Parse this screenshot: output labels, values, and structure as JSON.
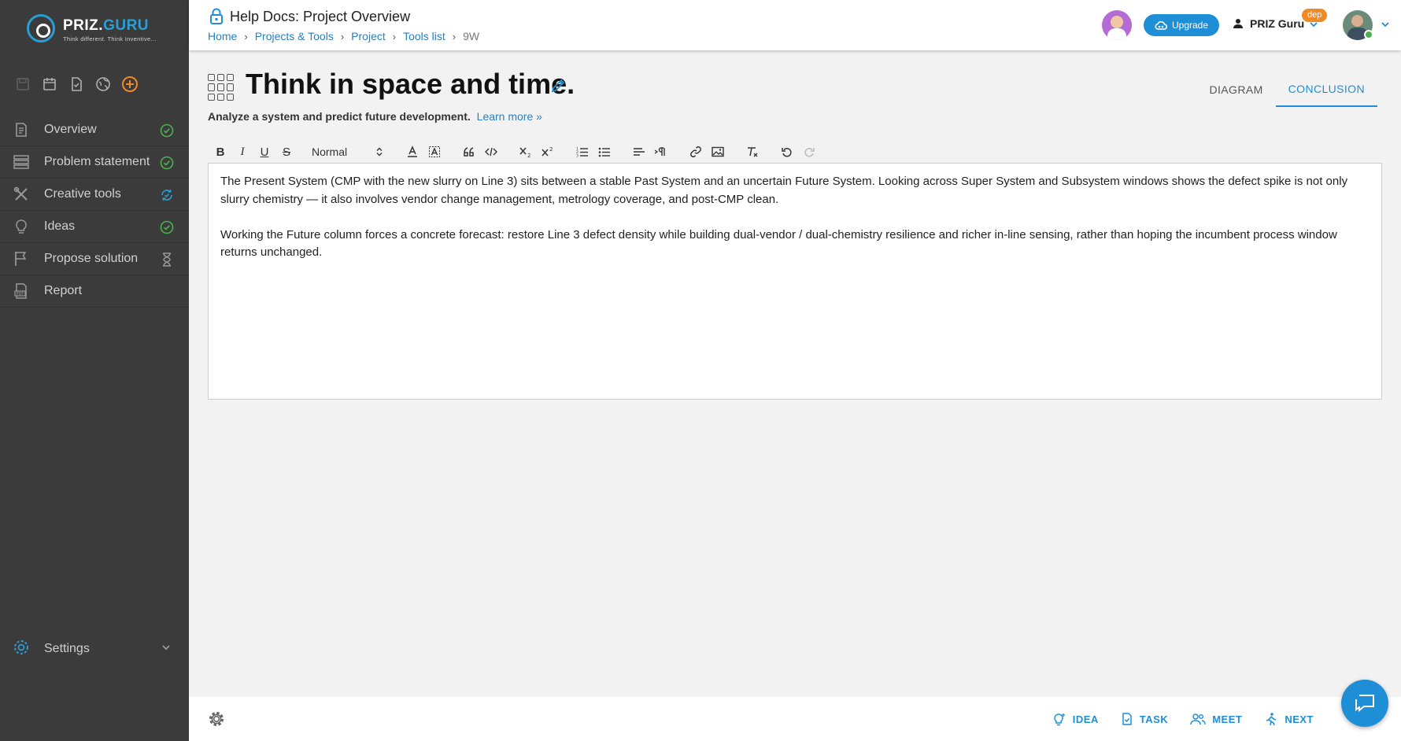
{
  "app": {
    "logo_text_main": "PRIZ.",
    "logo_text_accent": "GURU",
    "logo_tagline": "Think different. Think Inventive..."
  },
  "header": {
    "title": "Help Docs: Project Overview",
    "breadcrumb": [
      "Home",
      "Projects & Tools",
      "Project",
      "Tools list",
      "9W"
    ],
    "upgrade_label": "Upgrade",
    "user_label": "PRIZ Guru",
    "user_badge": "dep"
  },
  "sidebar": {
    "items": [
      {
        "label": "Overview",
        "icon": "overview-doc-icon",
        "status": "done"
      },
      {
        "label": "Problem statement",
        "icon": "problem-list-icon",
        "status": "done"
      },
      {
        "label": "Creative tools",
        "icon": "tools-icon",
        "status": "in-progress"
      },
      {
        "label": "Ideas",
        "icon": "lightbulb-icon",
        "status": "done"
      },
      {
        "label": "Propose solution",
        "icon": "flag-icon",
        "status": "pending"
      },
      {
        "label": "Report",
        "icon": "pdf-icon",
        "status": "none"
      }
    ],
    "settings_label": "Settings"
  },
  "main": {
    "title": "Think in space and time.",
    "subtitle": "Analyze a system and predict future development.",
    "learn_more": "Learn more »",
    "tabs": [
      {
        "label": "DIAGRAM",
        "active": false
      },
      {
        "label": "CONCLUSION",
        "active": true
      }
    ],
    "toolbar": {
      "heading_select": "Normal"
    },
    "editor": {
      "paragraphs": [
        "The Present System (CMP with the new slurry on Line 3) sits between a stable Past System and an uncertain Future System. Looking across Super System and Subsystem windows shows the defect spike is not only slurry chemistry — it also involves vendor change management, metrology coverage, and post-CMP clean.",
        "Working the Future column forces a concrete forecast: restore Line 3 defect density while building dual-vendor / dual-chemistry resilience and richer in-line sensing, rather than hoping the incumbent process window returns unchanged."
      ]
    }
  },
  "footer": {
    "actions": [
      "IDEA",
      "TASK",
      "MEET",
      "NEXT"
    ]
  },
  "colors": {
    "accent": "#1e8fd6",
    "sidebar_bg": "#3b3b3b",
    "done": "#4caf50",
    "badge": "#f08a24"
  }
}
